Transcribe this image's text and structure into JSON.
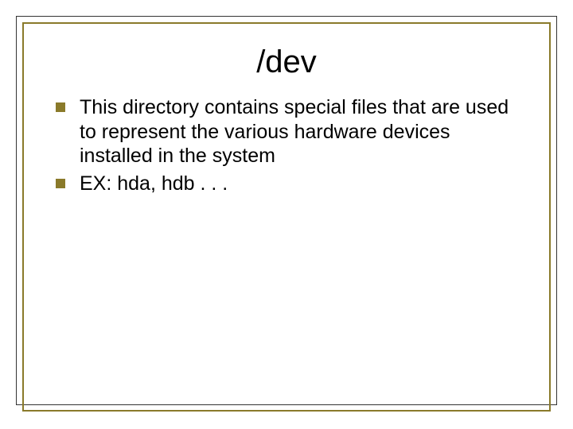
{
  "title": "/dev",
  "bullets": [
    {
      "text": " This directory contains special files that are used to represent the various hardware devices installed in the system"
    },
    {
      "text": "EX: hda, hdb . . ."
    }
  ]
}
